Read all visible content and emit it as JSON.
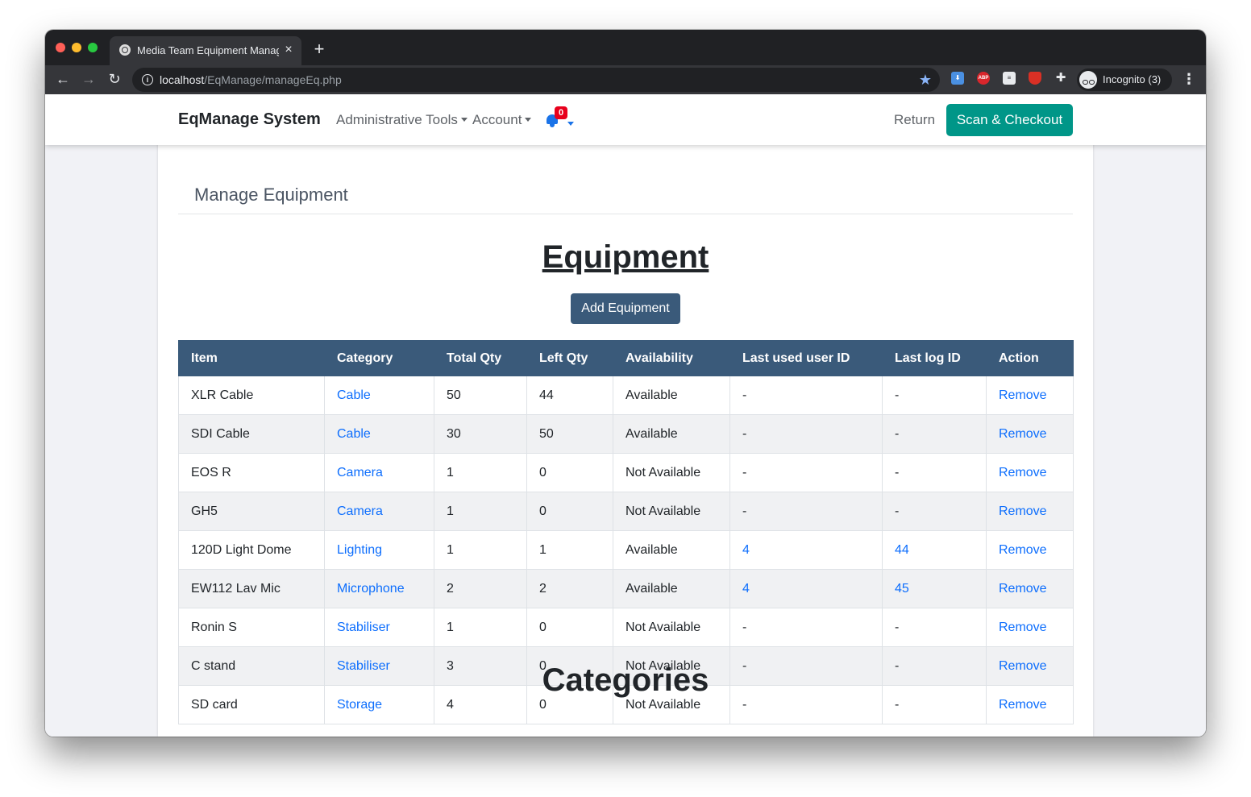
{
  "browser": {
    "tab_title": "Media Team Equipment Manag",
    "url_host": "localhost",
    "url_path": "/EqManage/manageEq.php",
    "incognito_label": "Incognito (3)",
    "extensions": [
      "download-icon",
      "adblock-icon",
      "document-icon",
      "shield-icon",
      "puzzle-icon"
    ]
  },
  "navbar": {
    "brand": "EqManage System",
    "admin_tools": "Administrative Tools",
    "account": "Account",
    "notification_count": "0",
    "return": "Return",
    "scan_checkout": "Scan & Checkout"
  },
  "page": {
    "heading": "Manage Equipment",
    "section_title": "Equipment",
    "add_button": "Add Equipment",
    "next_section_title": "Categories"
  },
  "table": {
    "headers": [
      "Item",
      "Category",
      "Total Qty",
      "Left Qty",
      "Availability",
      "Last used user ID",
      "Last log ID",
      "Action"
    ],
    "rows": [
      [
        "XLR Cable",
        "Cable",
        "50",
        "44",
        "Available",
        "-",
        "-",
        "Remove"
      ],
      [
        "SDI Cable",
        "Cable",
        "30",
        "50",
        "Available",
        "-",
        "-",
        "Remove"
      ],
      [
        "EOS R",
        "Camera",
        "1",
        "0",
        "Not Available",
        "-",
        "-",
        "Remove"
      ],
      [
        "GH5",
        "Camera",
        "1",
        "0",
        "Not Available",
        "-",
        "-",
        "Remove"
      ],
      [
        "120D Light Dome",
        "Lighting",
        "1",
        "1",
        "Available",
        "4",
        "44",
        "Remove"
      ],
      [
        "EW112 Lav Mic",
        "Microphone",
        "2",
        "2",
        "Available",
        "4",
        "45",
        "Remove"
      ],
      [
        "Ronin S",
        "Stabiliser",
        "1",
        "0",
        "Not Available",
        "-",
        "-",
        "Remove"
      ],
      [
        "C stand",
        "Stabiliser",
        "3",
        "0",
        "Not Available",
        "-",
        "-",
        "Remove"
      ],
      [
        "SD card",
        "Storage",
        "4",
        "0",
        "Not Available",
        "-",
        "-",
        "Remove"
      ]
    ]
  },
  "colors": {
    "header_bg": "#3a5a7a",
    "scan_button": "#009688",
    "link": "#0d6efd",
    "badge": "#e8001c"
  }
}
